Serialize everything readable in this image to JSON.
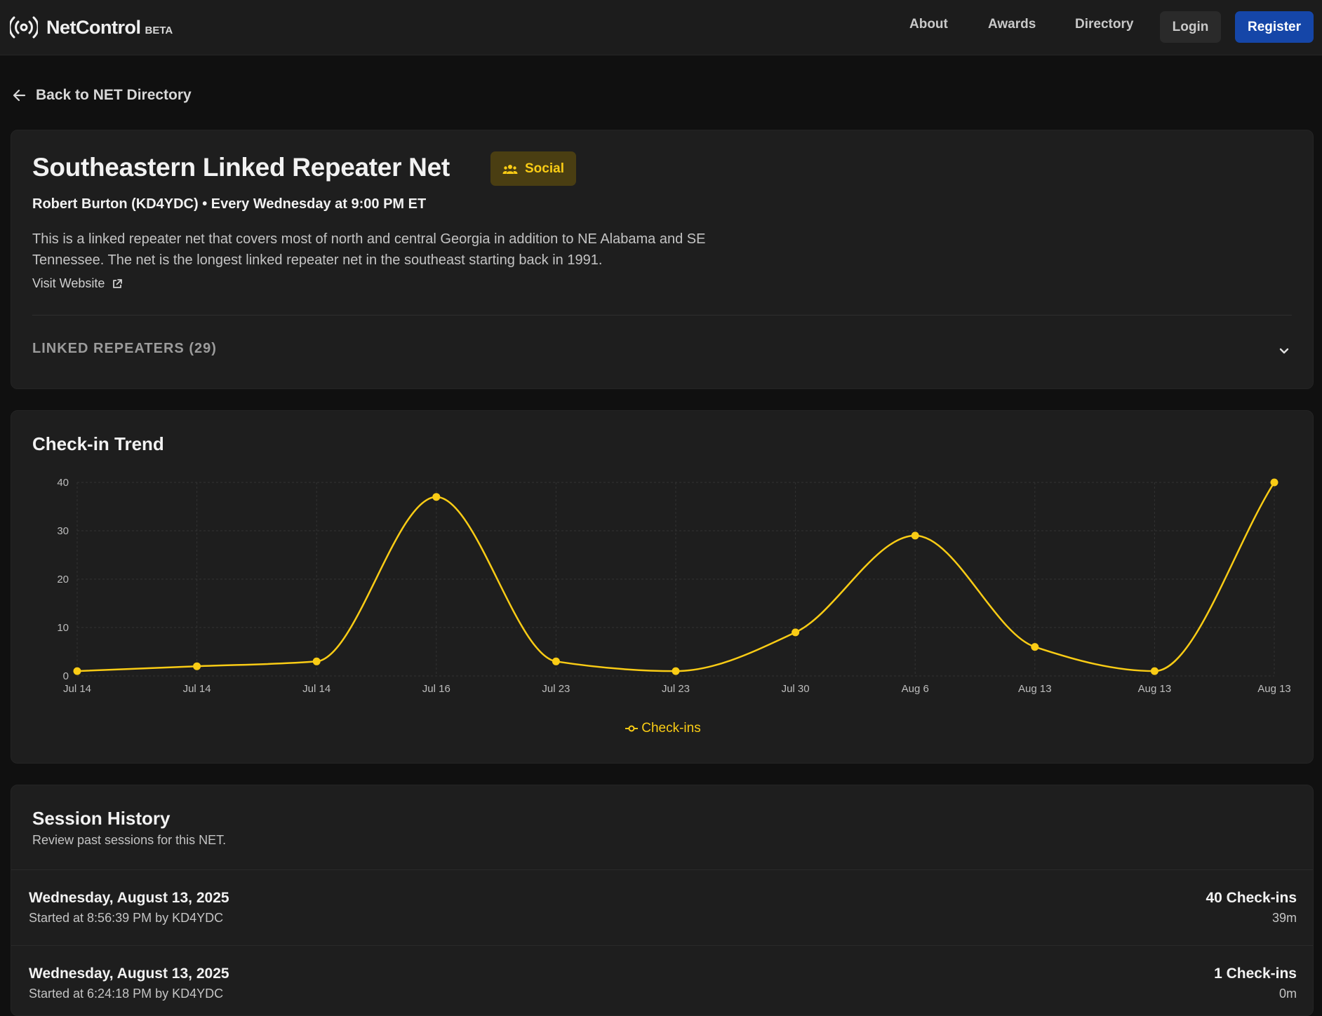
{
  "nav": {
    "brand": "NetControl",
    "beta": "BETA",
    "links": [
      "About",
      "Awards",
      "Directory"
    ],
    "login": "Login",
    "register": "Register"
  },
  "back_label": "Back to NET Directory",
  "net": {
    "title": "Southeastern Linked Repeater Net",
    "category": "Social",
    "subtitle": "Robert Burton (KD4YDC) • Every Wednesday at 9:00 PM ET",
    "description": "This is a linked repeater net that covers most of north and central Georgia in addition to NE Alabama and SE Tennessee. The net is the longest linked repeater net in the southeast starting back in 1991.",
    "visit_website": "Visit Website",
    "linked_repeaters": "LINKED REPEATERS (29)"
  },
  "colors": {
    "accent": "#facc15",
    "primary": "#1546a8",
    "background": "#101010",
    "card": "#1e1e1e"
  },
  "chart": {
    "title": "Check-in Trend"
  },
  "chart_data": {
    "type": "line",
    "categories": [
      "Jul 14",
      "Jul 14",
      "Jul 14",
      "Jul 16",
      "Jul 23",
      "Jul 23",
      "Jul 30",
      "Aug 6",
      "Aug 13",
      "Aug 13",
      "Aug 13"
    ],
    "series": [
      {
        "name": "Check-ins",
        "values": [
          1,
          2,
          3,
          37,
          3,
          1,
          9,
          29,
          6,
          1,
          40
        ],
        "color": "#facc15"
      }
    ],
    "ylim": [
      0,
      40
    ],
    "yticks": [
      0,
      10,
      20,
      30,
      40
    ],
    "grid": true,
    "curve": "smooth",
    "legend": "bottom-center"
  },
  "history": {
    "title": "Session History",
    "subtitle": "Review past sessions for this NET.",
    "sessions": [
      {
        "date": "Wednesday, August 13, 2025",
        "started": "Started at 8:56:39 PM by KD4YDC",
        "checkins": "40 Check-ins",
        "duration": "39m"
      },
      {
        "date": "Wednesday, August 13, 2025",
        "started": "Started at 6:24:18 PM by KD4YDC",
        "checkins": "1 Check-ins",
        "duration": "0m"
      }
    ]
  }
}
